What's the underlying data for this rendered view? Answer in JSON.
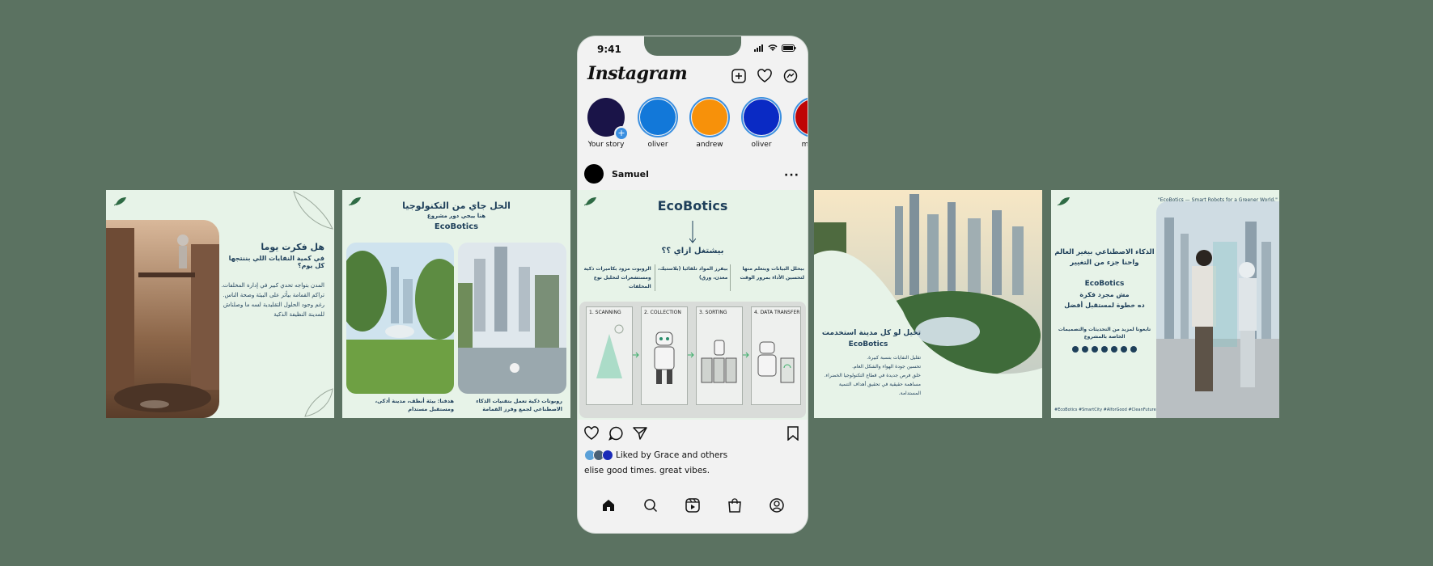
{
  "status": {
    "time": "9:41"
  },
  "app": {
    "logo": "Instagram"
  },
  "stories": [
    {
      "name": "Your story",
      "color": "#1a1448"
    },
    {
      "name": "oliver",
      "color": "#1278d9"
    },
    {
      "name": "andrew",
      "color": "#f7910a"
    },
    {
      "name": "oliver",
      "color": "#0a2ac4"
    },
    {
      "name": "mateo",
      "color": "#bf0505"
    }
  ],
  "post": {
    "username": "Samuel",
    "liked_by": "Liked by Grace and others",
    "caption": "elise good times. great vibes.",
    "title": "EcoBotics",
    "question": "بيشتغل ازاي ؟؟",
    "columns": [
      "بيحلل البيانات ويتعلم منها لتحسين الأداء بمرور الوقت",
      "بيفرز المواد تلقائيا (بلاستيك، معدن، ورق)",
      "الروبوت مزود بكاميرات ذكية ومستشعرات لتحليل نوع المخلفات"
    ],
    "steps": [
      "1. SCANNING",
      "2. COLLECTION",
      "3. SORTING",
      "4. DATA TRANSFER"
    ]
  },
  "slide1": {
    "heading1": "هل فكرت يوما",
    "heading2": "في كمية النفايات اللي بننتجها كل يوم؟",
    "body": [
      "المدن بتواجه تحدي كبير في إدارة المخلفات.",
      "تراكم القمامة بيأثر على البيئة وصحة الناس.",
      "رغم وجود الحلول التقليدية لسه ما وصلناش",
      "للمدينة النظيفة الذكية"
    ]
  },
  "slide2": {
    "heading": "الحل جاي من التكنولوجيا",
    "sub": "هنا ييجي دور مشروع",
    "brand": "EcoBotics",
    "caption_right": "روبوتات ذكية تعمل بتقنيات الذكاء الاصطناعي لجمع وفرز القمامة",
    "caption_left": "هدفنا: بيئة أنظف، مدينة أذكى، ومستقبل مستدام"
  },
  "slide4": {
    "heading": "تخيل لو كل مدينة استخدمت",
    "brand": "EcoBotics",
    "body": [
      "تقليل النفايات بنسبة كبيرة.",
      "تحسين جودة الهواء والشكل العام.",
      "خلق فرص جديدة في قطاع التكنولوجيا الخضراء.",
      "مساهمة حقيقية في تحقيق أهداف التنمية المستدامة."
    ]
  },
  "slide5": {
    "quote": "\"EcoBotics — Smart Robots for a Greener World.\"",
    "heading1": "الذكاء الاصطناعي بيغير العالم",
    "heading2": "واحنا جزء من التغيير",
    "brand": "EcoBotics",
    "line1": "مش مجرد فكرة",
    "line2": "ده خطوة لمستقبل أفضل",
    "follow1": "تابعونا لمزيد من التحديثات والتصميمات",
    "follow2": "الخاصة بالمشروع",
    "hashtags": "#EcoBotics #SmartCity #AIforGood #CleanFuture"
  }
}
